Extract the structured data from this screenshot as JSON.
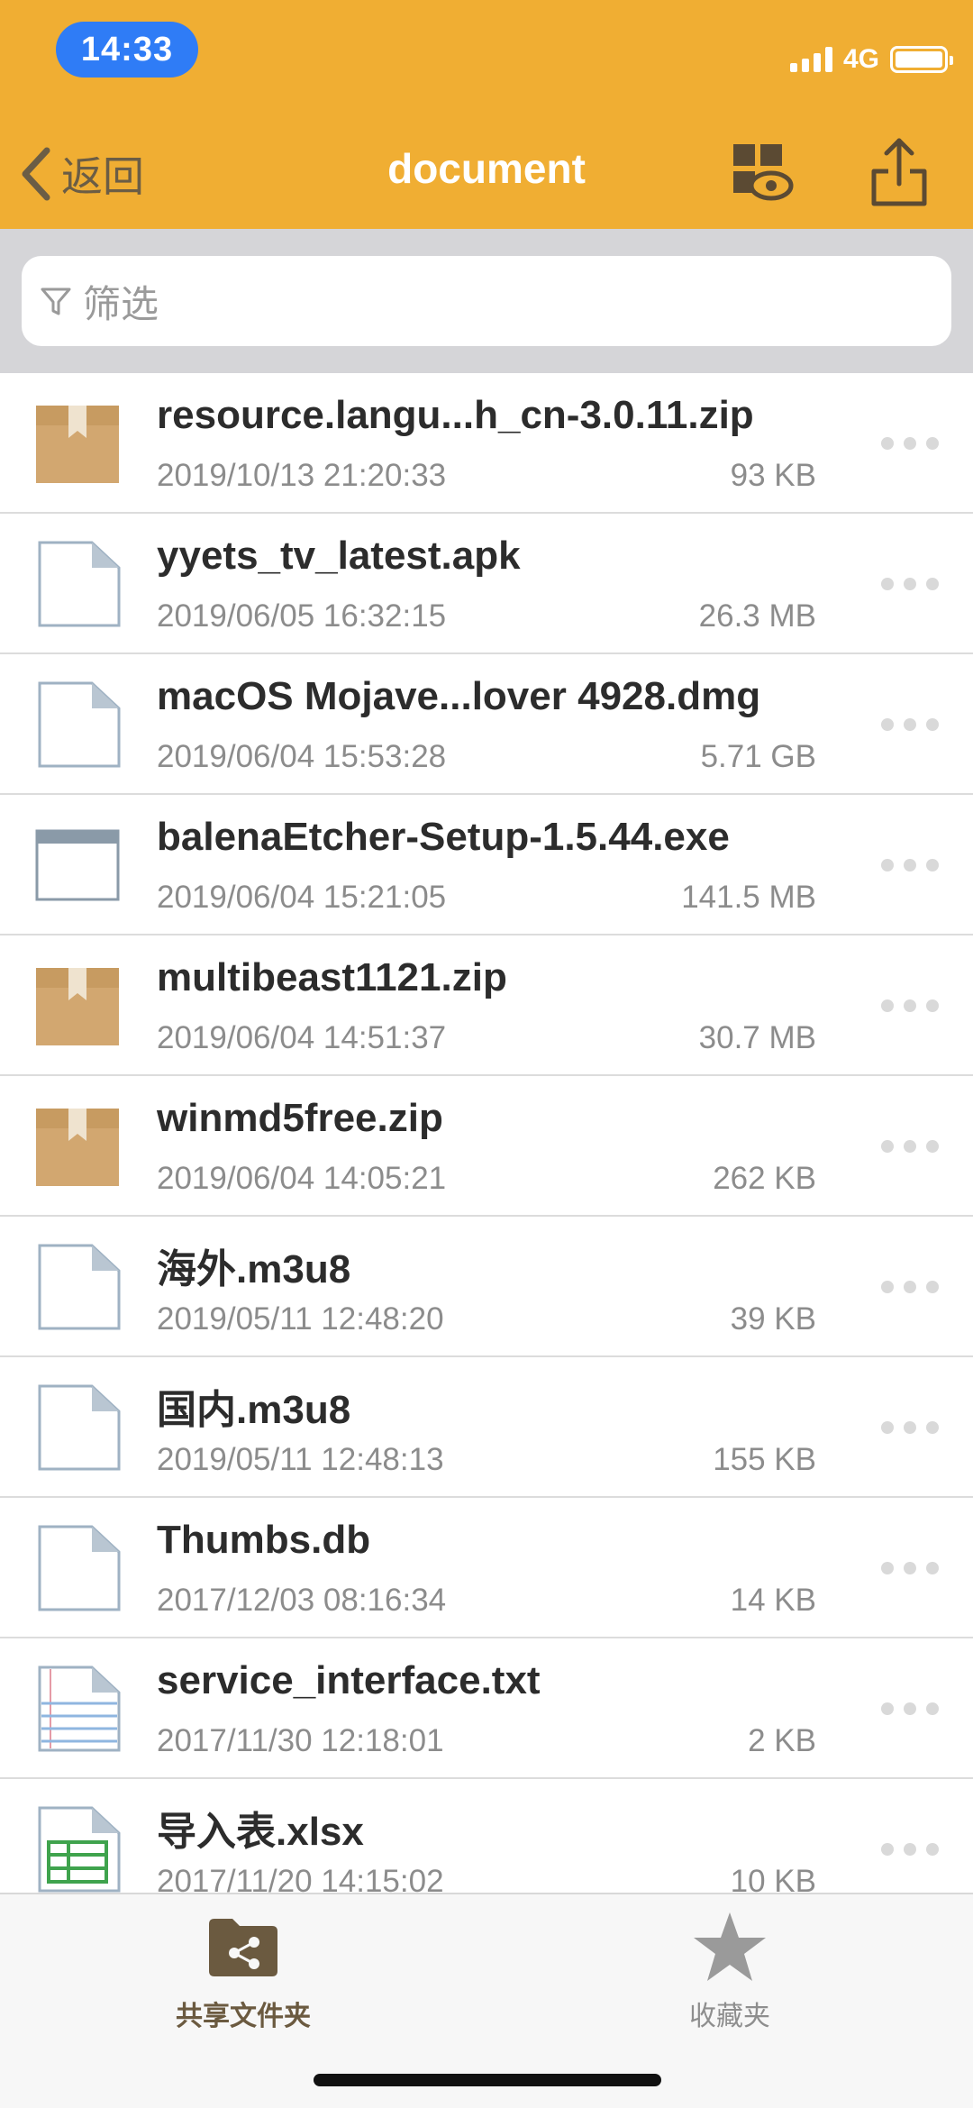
{
  "status_bar": {
    "time": "14:33",
    "network": "4G"
  },
  "navbar": {
    "back_label": "返回",
    "title": "document",
    "view_icon": "grid-eye-icon",
    "share_icon": "share-icon"
  },
  "filter": {
    "placeholder": "筛选"
  },
  "files": [
    {
      "name": "resource.langu...h_cn-3.0.11.zip",
      "date": "2019/10/13 21:20:33",
      "size": "93 KB",
      "icon": "archive-box-icon"
    },
    {
      "name": "yyets_tv_latest.apk",
      "date": "2019/06/05 16:32:15",
      "size": "26.3 MB",
      "icon": "blank-file-icon"
    },
    {
      "name": "macOS Mojave...lover 4928.dmg",
      "date": "2019/06/04 15:53:28",
      "size": "5.71 GB",
      "icon": "blank-file-icon"
    },
    {
      "name": "balenaEtcher-Setup-1.5.44.exe",
      "date": "2019/06/04 15:21:05",
      "size": "141.5 MB",
      "icon": "window-file-icon"
    },
    {
      "name": "multibeast1121.zip",
      "date": "2019/06/04 14:51:37",
      "size": "30.7 MB",
      "icon": "archive-box-icon"
    },
    {
      "name": "winmd5free.zip",
      "date": "2019/06/04 14:05:21",
      "size": "262 KB",
      "icon": "archive-box-icon"
    },
    {
      "name": "海外.m3u8",
      "date": "2019/05/11 12:48:20",
      "size": "39 KB",
      "icon": "blank-file-icon"
    },
    {
      "name": "国内.m3u8",
      "date": "2019/05/11 12:48:13",
      "size": "155 KB",
      "icon": "blank-file-icon"
    },
    {
      "name": "Thumbs.db",
      "date": "2017/12/03 08:16:34",
      "size": "14 KB",
      "icon": "blank-file-icon"
    },
    {
      "name": "service_interface.txt",
      "date": "2017/11/30 12:18:01",
      "size": "2 KB",
      "icon": "text-file-icon"
    },
    {
      "name": "导入表.xlsx",
      "date": "2017/11/20 14:15:02",
      "size": "10 KB",
      "icon": "spreadsheet-file-icon"
    }
  ],
  "tab_bar": {
    "tabs": [
      {
        "label": "共享文件夹",
        "icon": "shared-folder-icon",
        "active": true
      },
      {
        "label": "收藏夹",
        "icon": "star-icon",
        "active": false
      }
    ]
  },
  "colors": {
    "header": "#F0AE33",
    "time_pill": "#2F7CF6",
    "filter_bg": "#D5D5D8",
    "archive": "#D2A770",
    "tab_active": "#6b5a40"
  }
}
